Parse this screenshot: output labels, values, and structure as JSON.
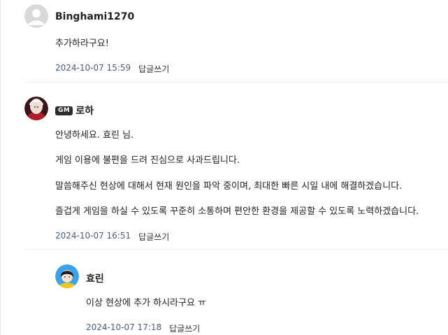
{
  "comments": [
    {
      "author": "Binghami1270",
      "lines": [
        "추가하라구요!"
      ],
      "time": "2024-10-07 15:59",
      "reply_label": "답글쓰기"
    },
    {
      "badge": "GM",
      "author": "로하",
      "lines": [
        "안녕하세요. 효린 님.",
        "게임 이용에 불편을 드려 진심으로 사과드립니다.",
        "말씀해주신 현상에 대해서 현재 원인을 파악 중이며, 최대한 빠른 시일 내에 해결하겠습니다.",
        "즐겁게 게임을 하실 수 있도록 꾸준히 소통하며 편안한 환경을 제공할 수 있도록 노력하겠습니다."
      ],
      "time": "2024-10-07 16:51",
      "reply_label": "답글쓰기"
    },
    {
      "author": "효린",
      "lines": [
        "이상 현상에 추가 하시라구요 ㅠ"
      ],
      "time": "2024-10-07 17:18",
      "reply_label": "답글쓰기"
    }
  ]
}
